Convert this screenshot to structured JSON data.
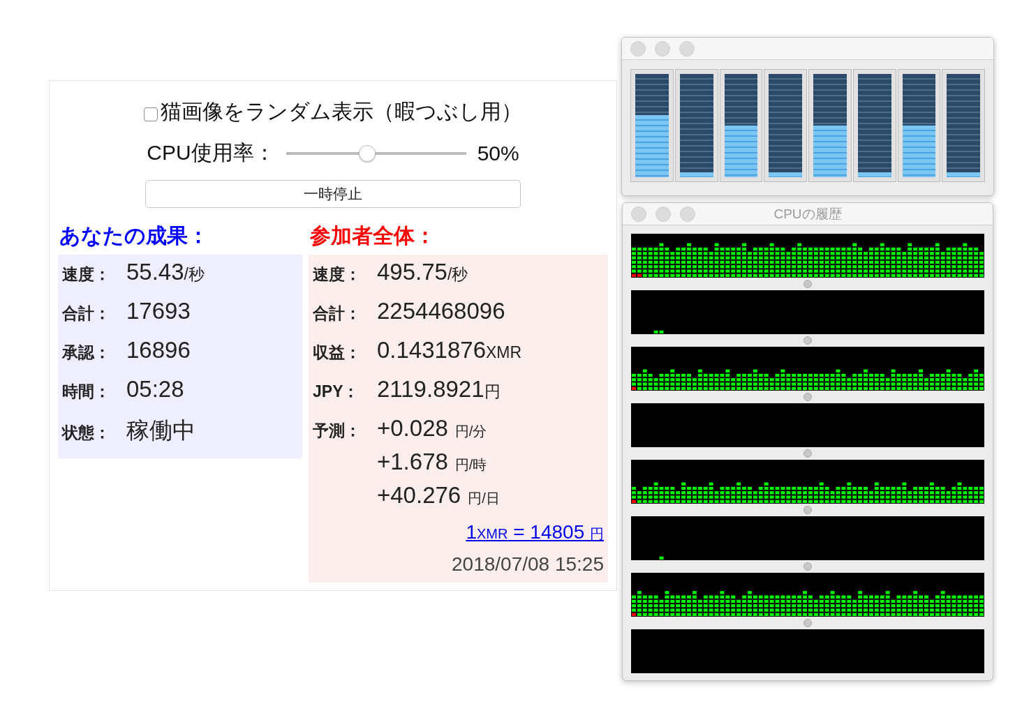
{
  "checkbox": {
    "label": "猫画像をランダム表示（暇つぶし用）",
    "checked": false
  },
  "cpu": {
    "label": "CPU使用率：",
    "level": 0.45,
    "reading": "50%"
  },
  "pause_button": {
    "label": "一時停止"
  },
  "yours": {
    "title": "あなたの成果：",
    "rows": [
      {
        "label": "速度：",
        "value": "55.43",
        "unit": "/秒"
      },
      {
        "label": "合計：",
        "value": "17693"
      },
      {
        "label": "承認：",
        "value": "16896"
      },
      {
        "label": "時間：",
        "value": "05:28"
      },
      {
        "label": "状態：",
        "value": "稼働中"
      }
    ]
  },
  "all": {
    "title": "参加者全体：",
    "rows": [
      {
        "label": "速度：",
        "value": "495.75",
        "unit": "/秒"
      },
      {
        "label": "合計：",
        "value": "2254468096"
      },
      {
        "label": "収益：",
        "value": "0.1431876",
        "unit": "XMR"
      },
      {
        "label": "JPY：",
        "value": "2119.8921",
        "unit": "円"
      }
    ],
    "forecast": {
      "label": "予測：",
      "items": [
        {
          "value": "+0.028",
          "unit": "円/分"
        },
        {
          "value": "+1.678",
          "unit": "円/時"
        },
        {
          "value": "+40.276",
          "unit": "円/日"
        }
      ]
    },
    "rate_link": [
      {
        "text": "1",
        "small": false
      },
      {
        "text": "XMR",
        "small": true
      },
      {
        "text": " = 14805 ",
        "small": false
      },
      {
        "text": "円",
        "small": true
      }
    ],
    "timestamp": "2018/07/08 15:25"
  },
  "meters": [
    {
      "level": 0.6
    },
    {
      "level": 0.05
    },
    {
      "level": 0.5
    },
    {
      "level": 0.05
    },
    {
      "level": 0.5
    },
    {
      "level": 0.05
    },
    {
      "level": 0.5
    },
    {
      "level": 0.05
    }
  ],
  "history_window": {
    "title": "CPUの履歴"
  }
}
